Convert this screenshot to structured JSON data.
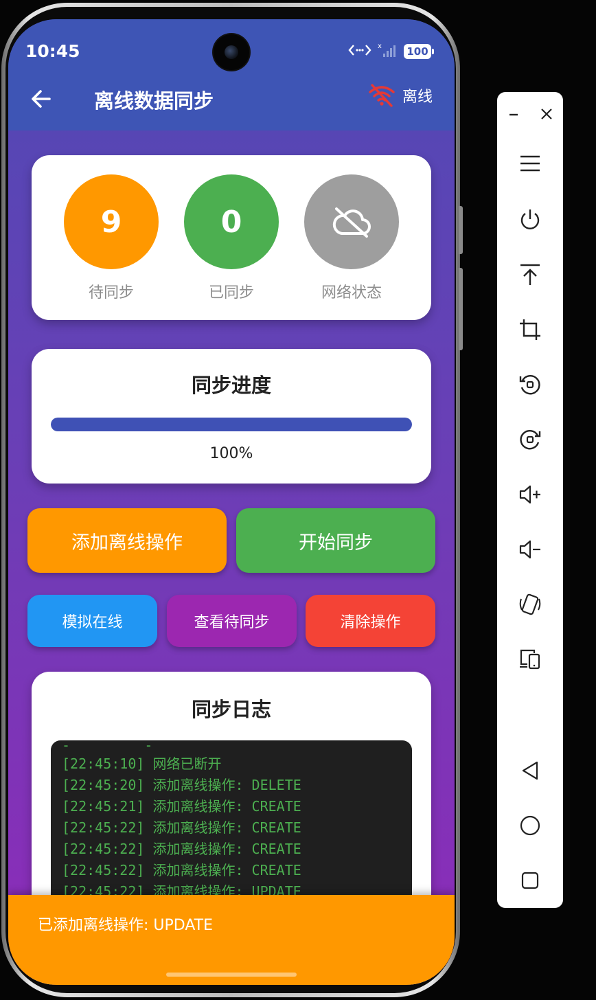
{
  "status_bar": {
    "time": "10:45",
    "battery": "100"
  },
  "app_bar": {
    "title": "离线数据同步",
    "network_label": "离线"
  },
  "stats": [
    {
      "value": "9",
      "label": "待同步",
      "color": "#ff9800"
    },
    {
      "value": "0",
      "label": "已同步",
      "color": "#4caf50"
    },
    {
      "value": "",
      "label": "网络状态",
      "color": "#9e9e9e",
      "icon": "cloud-off-icon"
    }
  ],
  "progress": {
    "title": "同步进度",
    "percent_text": "100%",
    "fraction": 1.0
  },
  "buttons": {
    "add_offline": {
      "label": "添加离线操作",
      "color": "#ff9800"
    },
    "start_sync": {
      "label": "开始同步",
      "color": "#4caf50"
    },
    "simulate_online": {
      "label": "模拟在线",
      "color": "#2196f3"
    },
    "view_pending": {
      "label": "查看待同步",
      "color": "#9c27b0"
    },
    "clear_ops": {
      "label": "清除操作",
      "color": "#f44336"
    }
  },
  "log": {
    "title": "同步日志",
    "lines": [
      "-         -",
      "[22:45:10] 网络已断开",
      "[22:45:20] 添加离线操作: DELETE",
      "[22:45:21] 添加离线操作: CREATE",
      "[22:45:22] 添加离线操作: CREATE",
      "[22:45:22] 添加离线操作: CREATE",
      "[22:45:22] 添加离线操作: CREATE",
      "[22:45:22] 添加离线操作: UPDATE"
    ]
  },
  "snackbar": {
    "text": "已添加离线操作: UPDATE"
  },
  "emulator_toolbar": {
    "items": [
      "minimize-icon",
      "close-icon",
      "menu-icon",
      "power-icon",
      "upload-icon",
      "crop-icon",
      "rotate-left-icon",
      "rotate-right-icon",
      "volume-up-icon",
      "volume-down-icon",
      "shake-icon",
      "device-switch-icon",
      "back-nav-icon",
      "home-nav-icon",
      "recents-nav-icon"
    ]
  }
}
